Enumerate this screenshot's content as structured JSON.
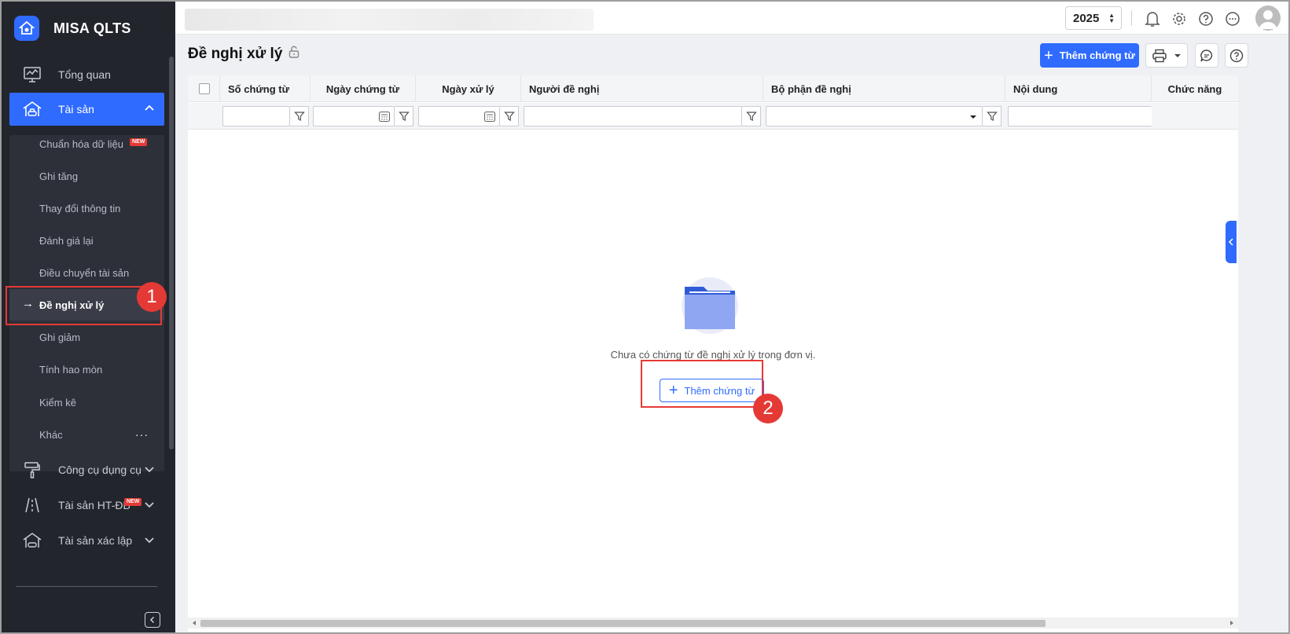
{
  "app": {
    "name": "MISA QLTS"
  },
  "sidebar": {
    "items": [
      {
        "label": "Tổng quan",
        "icon": "monitor-chart-icon"
      },
      {
        "label": "Tài sản",
        "icon": "building-car-icon"
      },
      {
        "label": "Công cụ dụng cụ",
        "icon": "paint-roller-icon"
      },
      {
        "label": "Tài sản HT-ĐB",
        "icon": "road-icon",
        "badge": "NEW"
      },
      {
        "label": "Tài sản xác lập",
        "icon": "house-car-icon"
      }
    ],
    "submenu": [
      {
        "label": "Chuẩn hóa dữ liệu",
        "badge": "NEW"
      },
      {
        "label": "Ghi tăng"
      },
      {
        "label": "Thay đổi thông tin"
      },
      {
        "label": "Đánh giá lại"
      },
      {
        "label": "Điều chuyển tài sản"
      },
      {
        "label": "Đề nghị xử lý"
      },
      {
        "label": "Ghi giảm"
      },
      {
        "label": "Tính hao mòn"
      },
      {
        "label": "Kiểm kê"
      },
      {
        "label": "Khác",
        "more": "···"
      }
    ],
    "active_arrow": "→"
  },
  "topbar": {
    "year": "2025",
    "icons": [
      "bell-icon",
      "gear-icon",
      "help-icon",
      "more-icon",
      "avatar"
    ]
  },
  "page": {
    "title": "Đề nghị xử lý",
    "add_button": "Thêm chứng từ"
  },
  "table": {
    "columns": [
      "Số chứng từ",
      "Ngày chứng từ",
      "Ngày xử lý",
      "Người đề nghị",
      "Bộ phận đề nghị",
      "Nội dung",
      "Chức năng"
    ]
  },
  "empty": {
    "message": "Chưa có chứng từ đề nghị xử lý trong đơn vị.",
    "button": "Thêm chứng từ"
  },
  "annotations": [
    "1",
    "2"
  ],
  "colors": {
    "primary": "#2f6bff",
    "sidebar": "#23252d",
    "annotation": "#e53935"
  }
}
